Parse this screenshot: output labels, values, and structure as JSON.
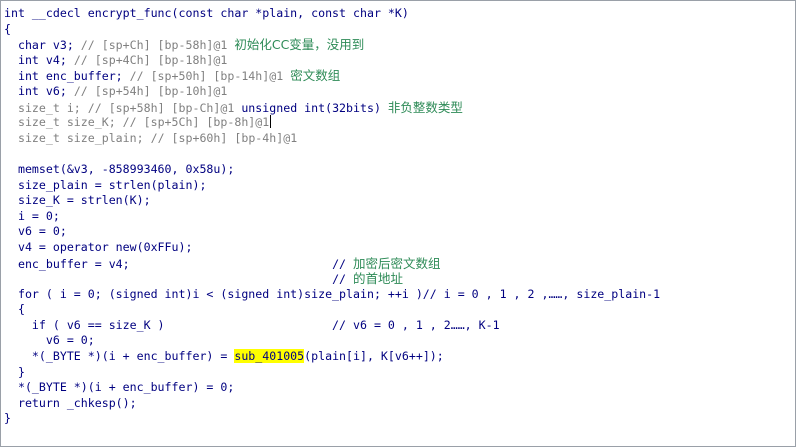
{
  "code_lines": [
    {
      "segments": [
        {
          "t": "int __cdecl encrypt_func(const char *plain, const char *K)",
          "c": "id"
        }
      ]
    },
    {
      "segments": [
        {
          "t": "{",
          "c": "id"
        }
      ]
    },
    {
      "segments": [
        {
          "t": "  char v3; ",
          "c": "id"
        },
        {
          "t": "// [sp+Ch] [bp-58h]@1 ",
          "c": "cmt"
        },
        {
          "t": "初始化CC变量，没用到",
          "c": "cn"
        }
      ]
    },
    {
      "segments": [
        {
          "t": "  int v4; ",
          "c": "id"
        },
        {
          "t": "// [sp+4Ch] [bp-18h]@1",
          "c": "cmt"
        }
      ]
    },
    {
      "segments": [
        {
          "t": "  int enc_buffer; ",
          "c": "id"
        },
        {
          "t": "// [sp+50h] [bp-14h]@1 ",
          "c": "cmt"
        },
        {
          "t": "密文数组",
          "c": "cn"
        }
      ]
    },
    {
      "segments": [
        {
          "t": "  int v6; ",
          "c": "id"
        },
        {
          "t": "// [sp+54h] [bp-10h]@1",
          "c": "cmt"
        }
      ]
    },
    {
      "segments": [
        {
          "t": "  size_t i; ",
          "c": "dim"
        },
        {
          "t": "// [sp+58h] [bp-Ch]@1 ",
          "c": "cmt"
        },
        {
          "t": "unsigned int(32bits) ",
          "c": "id"
        },
        {
          "t": "非负整数类型",
          "c": "cn"
        }
      ]
    },
    {
      "segments": [
        {
          "t": "  size_t size_K; ",
          "c": "dim"
        },
        {
          "t": "// [sp+5Ch] [bp-8h]@1",
          "c": "cmt"
        },
        {
          "t": "",
          "c": "cursor"
        }
      ]
    },
    {
      "segments": [
        {
          "t": "  size_t size_plain; ",
          "c": "dim"
        },
        {
          "t": "// [sp+60h] [bp-4h]@1",
          "c": "cmt"
        }
      ]
    },
    {
      "segments": [
        {
          "t": "",
          "c": "id"
        }
      ]
    },
    {
      "segments": [
        {
          "t": "  memset(&v3, -858993460, 0x58u);",
          "c": "id"
        }
      ]
    },
    {
      "segments": [
        {
          "t": "  size_plain = strlen(plain);",
          "c": "id"
        }
      ]
    },
    {
      "segments": [
        {
          "t": "  size_K = strlen(K);",
          "c": "id"
        }
      ]
    },
    {
      "segments": [
        {
          "t": "  i = 0;",
          "c": "id"
        }
      ]
    },
    {
      "segments": [
        {
          "t": "  v6 = 0;",
          "c": "id"
        }
      ]
    },
    {
      "segments": [
        {
          "t": "  v4 = operator new(0xFFu);",
          "c": "id"
        }
      ]
    },
    {
      "segments": [
        {
          "t": "  enc_buffer = v4;                             ",
          "c": "id"
        },
        {
          "t": "// ",
          "c": "id"
        },
        {
          "t": "加密后密文数组",
          "c": "cn"
        }
      ]
    },
    {
      "segments": [
        {
          "t": "                                               ",
          "c": "id"
        },
        {
          "t": "// ",
          "c": "id"
        },
        {
          "t": "的首地址",
          "c": "cn"
        }
      ]
    },
    {
      "segments": [
        {
          "t": "  for ( i = 0; (signed int)i < (signed int)size_plain; ++i )// i = 0 , 1 , 2 ,……, size_plain-1",
          "c": "id"
        }
      ]
    },
    {
      "segments": [
        {
          "t": "  {",
          "c": "id"
        }
      ]
    },
    {
      "segments": [
        {
          "t": "    if ( v6 == size_K )                        // v6 = 0 , 1 , 2……, K-1",
          "c": "id"
        }
      ]
    },
    {
      "segments": [
        {
          "t": "      v6 = 0;",
          "c": "id"
        }
      ]
    },
    {
      "segments": [
        {
          "t": "    *(_BYTE *)(i + enc_buffer) = ",
          "c": "id"
        },
        {
          "t": "sub_401005",
          "c": "hl"
        },
        {
          "t": "(plain[i], K[v6++]);",
          "c": "id"
        }
      ]
    },
    {
      "segments": [
        {
          "t": "  }",
          "c": "id"
        }
      ]
    },
    {
      "segments": [
        {
          "t": "  *(_BYTE *)(i + enc_buffer) = 0;",
          "c": "id"
        }
      ]
    },
    {
      "segments": [
        {
          "t": "  return _chkesp();",
          "c": "id"
        }
      ]
    },
    {
      "segments": [
        {
          "t": "}",
          "c": "id"
        }
      ]
    }
  ]
}
